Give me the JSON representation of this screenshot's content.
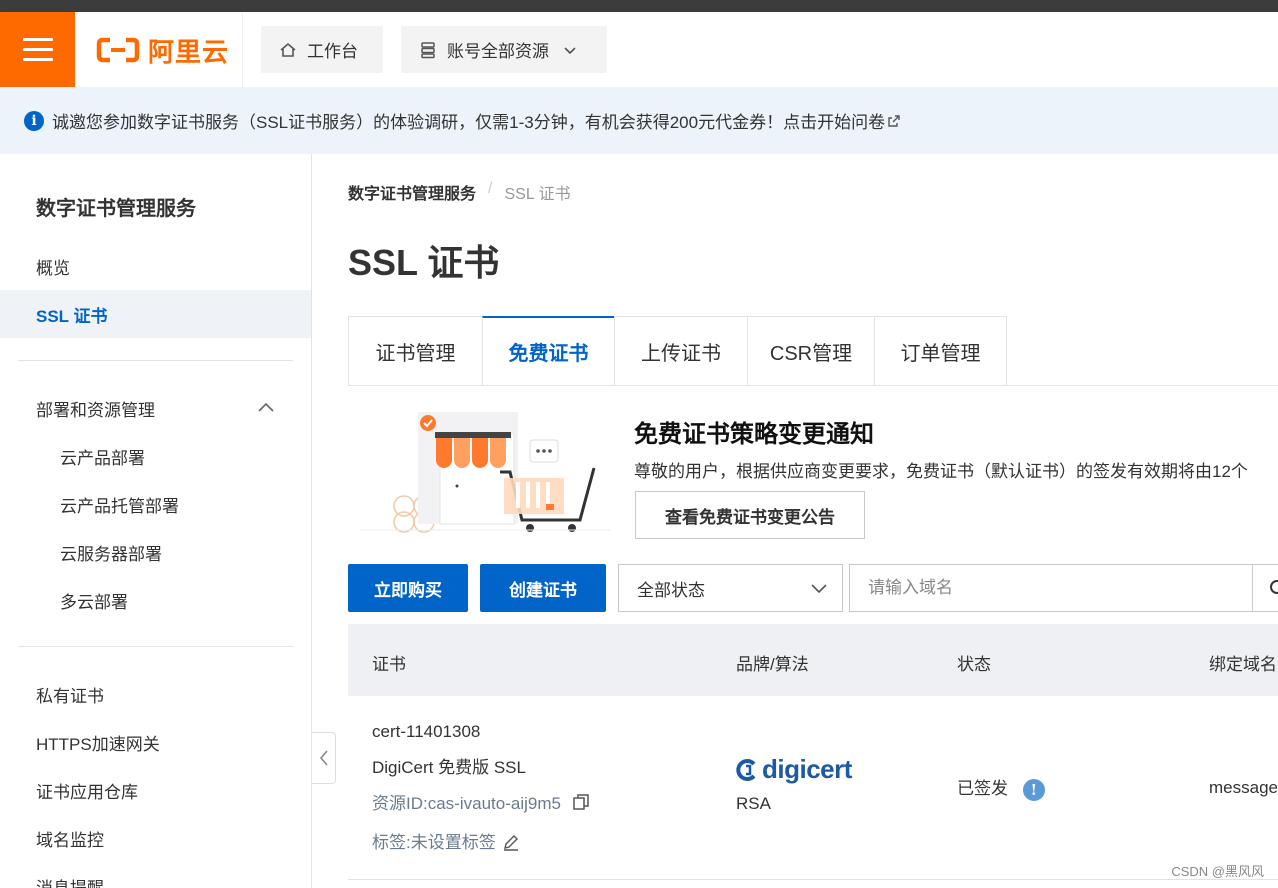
{
  "header": {
    "logo_text": "阿里云",
    "workbench_label": "工作台",
    "resources_label": "账号全部资源",
    "brand_color": "#ff6a00"
  },
  "notice": {
    "text": "诚邀您参加数字证书服务（SSL证书服务）的体验调研，仅需1-3分钟，有机会获得200元代金券！点击开始问卷"
  },
  "sidebar": {
    "title": "数字证书管理服务",
    "items": [
      {
        "label": "概览"
      },
      {
        "label": "SSL 证书"
      },
      {
        "label": "部署和资源管理"
      },
      {
        "label": "云产品部署"
      },
      {
        "label": "云产品托管部署"
      },
      {
        "label": "云服务器部署"
      },
      {
        "label": "多云部署"
      },
      {
        "label": "私有证书"
      },
      {
        "label": "HTTPS加速网关"
      },
      {
        "label": "证书应用仓库"
      },
      {
        "label": "域名监控"
      },
      {
        "label": "消息提醒"
      }
    ]
  },
  "breadcrumb": {
    "root": "数字证书管理服务",
    "separator": "/",
    "current": "SSL 证书"
  },
  "page_title": "SSL 证书",
  "tabs": [
    {
      "label": "证书管理"
    },
    {
      "label": "免费证书"
    },
    {
      "label": "上传证书"
    },
    {
      "label": "CSR管理"
    },
    {
      "label": "订单管理"
    }
  ],
  "promo": {
    "title": "免费证书策略变更通知",
    "description": "尊敬的用户，根据供应商变更要求，免费证书（默认证书）的签发有效期将由12个",
    "button_label": "查看免费证书变更公告"
  },
  "toolbar": {
    "buy_label": "立即购买",
    "create_label": "创建证书",
    "status_select": "全部状态",
    "search_placeholder": "请输入域名"
  },
  "table": {
    "headers": [
      "证书",
      "品牌/算法",
      "状态",
      "绑定域名"
    ],
    "rows": [
      {
        "cert_name": "cert-11401308",
        "cert_type": "DigiCert 免费版 SSL",
        "resource_id": "资源ID:cas-ivauto-aij9m5",
        "tags": "标签:未设置标签",
        "brand": "digicert",
        "algorithm": "RSA",
        "status": "已签发",
        "domain": "message"
      }
    ]
  },
  "watermark": "CSDN @黑风风",
  "colors": {
    "primary": "#0064c8",
    "orange": "#ff6a00"
  }
}
